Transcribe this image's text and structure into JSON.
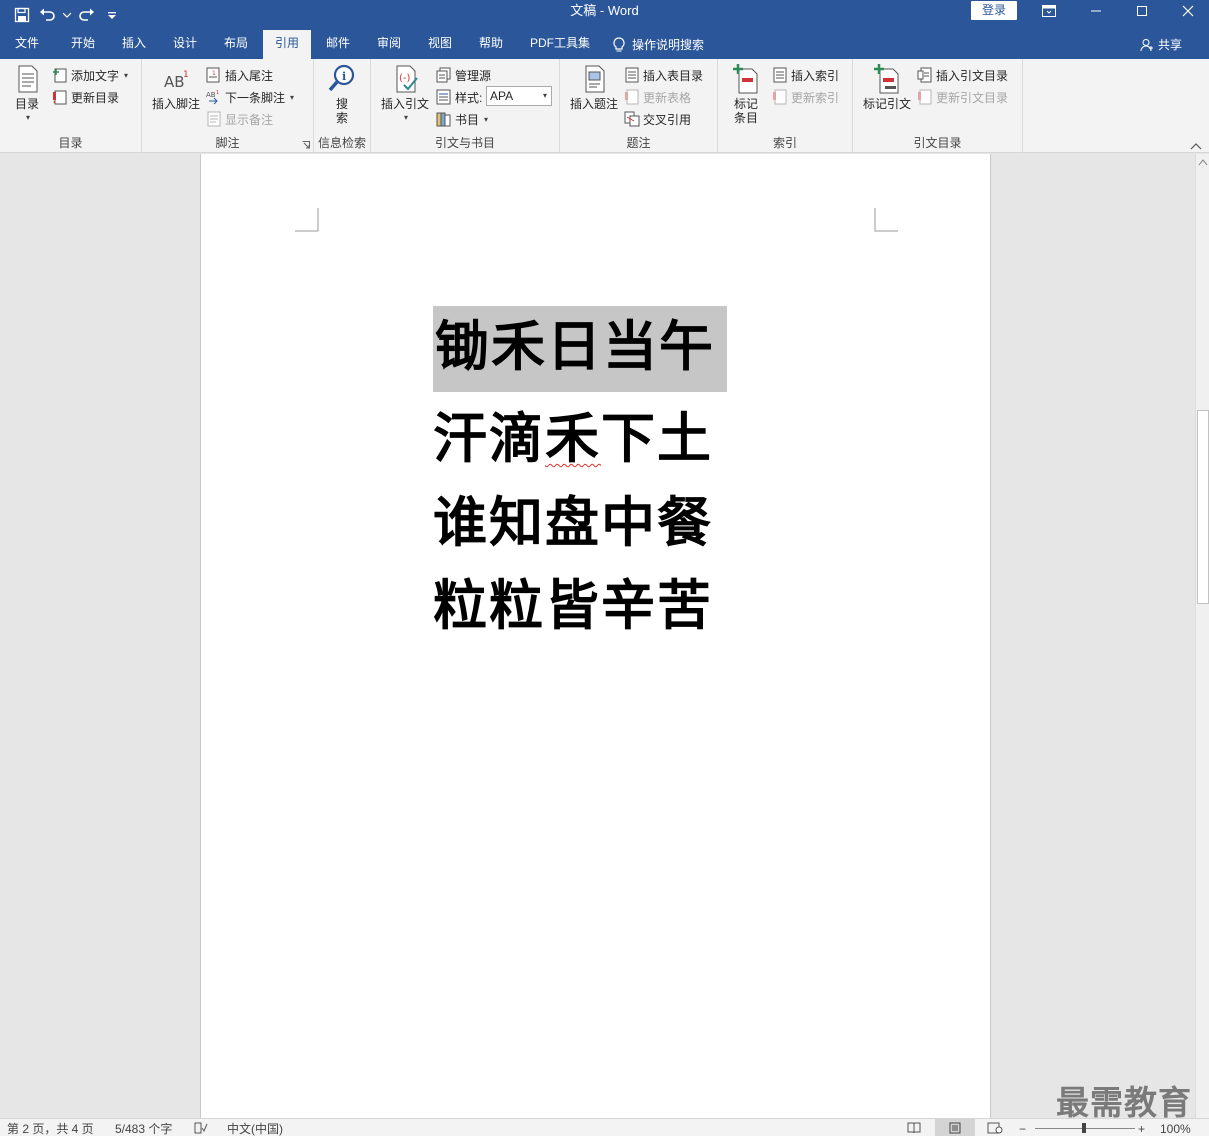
{
  "window": {
    "title": "文稿 - Word",
    "login_label": "登录"
  },
  "tabs": [
    {
      "label": "文件"
    },
    {
      "label": "开始"
    },
    {
      "label": "插入"
    },
    {
      "label": "设计"
    },
    {
      "label": "布局"
    },
    {
      "label": "引用"
    },
    {
      "label": "邮件"
    },
    {
      "label": "审阅"
    },
    {
      "label": "视图"
    },
    {
      "label": "帮助"
    },
    {
      "label": "PDF工具集"
    },
    {
      "label": "操作说明搜索"
    }
  ],
  "active_tab": "引用",
  "share_label": "共享",
  "ribbon": {
    "toc": {
      "toc_btn": "目录",
      "add_text": "添加文字",
      "update_toc": "更新目录",
      "label": "目录"
    },
    "footnotes": {
      "insert_footnote": "插入脚注",
      "insert_endnote": "插入尾注",
      "next_footnote": "下一条脚注",
      "show_notes": "显示备注",
      "label": "脚注"
    },
    "research": {
      "search_line1": "搜",
      "search_line2": "索",
      "label": "信息检索"
    },
    "citations": {
      "insert_citation": "插入引文",
      "manage_sources": "管理源",
      "style_label": "样式:",
      "style_value": "APA",
      "bibliography": "书目",
      "label": "引文与书目"
    },
    "captions": {
      "insert_caption": "插入题注",
      "insert_tof": "插入表目录",
      "update_table": "更新表格",
      "cross_ref": "交叉引用",
      "label": "题注"
    },
    "index": {
      "mark_entry_line1": "标记",
      "mark_entry_line2": "条目",
      "insert_index": "插入索引",
      "update_index": "更新索引",
      "label": "索引"
    },
    "toa": {
      "mark_citation": "标记引文",
      "insert_toa": "插入引文目录",
      "update_toa": "更新引文目录",
      "label": "引文目录"
    }
  },
  "document": {
    "lines": [
      {
        "text": "锄禾日当午"
      },
      {
        "pre": "汗滴",
        "squiggle": "禾",
        "post": "下土"
      },
      {
        "text": "谁知盘中餐"
      },
      {
        "text": "粒粒皆辛苦"
      }
    ]
  },
  "status": {
    "page": "第 2 页，共 4 页",
    "words": "5/483 个字",
    "language": "中文(中国)",
    "zoom": "100%"
  },
  "watermark": "最需教育",
  "colors": {
    "title_bar": "#2b579a",
    "ribbon": "#f3f3f3",
    "selection": "#c6c6c6"
  }
}
